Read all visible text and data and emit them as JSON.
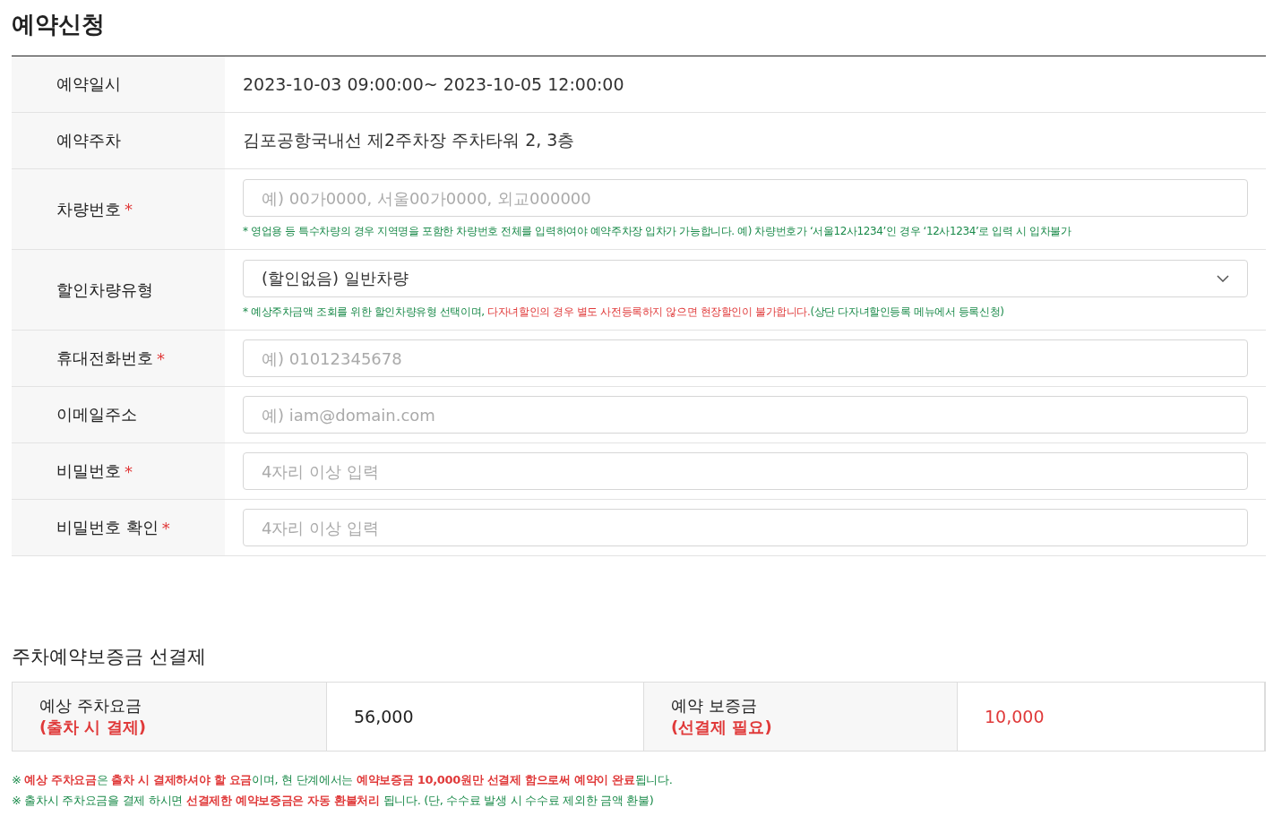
{
  "title": "예약신청",
  "rows": [
    {
      "label": "예약일시",
      "required": false,
      "kind": "text",
      "value": "2023-10-03 09:00:00~ 2023-10-05 12:00:00"
    },
    {
      "label": "예약주차",
      "required": false,
      "kind": "text",
      "value": "김포공항국내선 제2주차장 주차타워 2, 3층"
    },
    {
      "label": "차량번호",
      "required": true,
      "kind": "field",
      "placeholder": "예) 00가0000, 서울00가0000, 외교000000",
      "note": [
        {
          "text": "* 영업용 등 특수차량의 경우 지역명을 포함한 차량번호 전체를 입력하여야 예약주차장 입차가 가능합니다. 예) 차량번호가 ‘서울12사1234’인 경우 ‘12사1234’로 입력 시 입차불가",
          "highlight": false
        }
      ]
    },
    {
      "label": "할인차량유형",
      "required": false,
      "kind": "select",
      "value": "(할인없음) 일반차량",
      "note": [
        {
          "text": "* 예상주차금액 조회를 위한 할인차량유형 선택이며, ",
          "highlight": false
        },
        {
          "text": "다자녀할인의 경우 별도 사전등록하지 않으면 현장할인이 불가합니다.",
          "highlight": true
        },
        {
          "text": "(상단 다자녀할인등록 메뉴에서 등록신청)",
          "highlight": false
        }
      ]
    },
    {
      "label": "휴대전화번호",
      "required": true,
      "kind": "field",
      "placeholder": "예) 01012345678"
    },
    {
      "label": "이메일주소",
      "required": false,
      "kind": "field",
      "placeholder": "예) iam@domain.com"
    },
    {
      "label": "비밀번호",
      "required": true,
      "kind": "field",
      "placeholder": "4자리 이상 입력"
    },
    {
      "label": "비밀번호 확인",
      "required": true,
      "kind": "field",
      "placeholder": "4자리 이상 입력"
    }
  ],
  "star": "*",
  "deposit": {
    "title": "주차예약보증금 선결제",
    "cells": [
      {
        "label": "예상 주차요금",
        "sublabel": "(출차 시 결제)",
        "value": "56,000",
        "highlight": false
      },
      {
        "label": "예약 보증금",
        "sublabel": "(선결제 필요)",
        "value": "10,000",
        "highlight": true
      }
    ],
    "notes": [
      "※ **예상 주차요금**은 **출차 시 결제하셔야 할 요금**이며, 현 단계에서는 **예약보증금 10,000원만 선결제 함으로써 예약이 완료**됩니다.",
      "※ 출차시 주차요금을 결제 하시면 **선결제한 예약보증금은 자동 환불처리** 됩니다. (단, 수수료 발생 시 수수료 제외한 금액 환불)"
    ]
  }
}
